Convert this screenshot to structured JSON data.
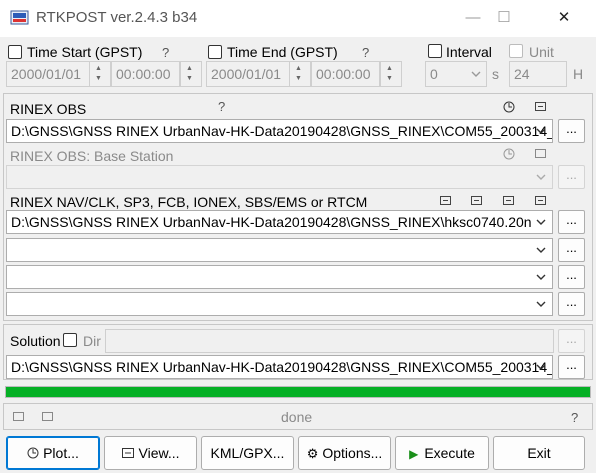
{
  "window": {
    "title": "RTKPOST ver.2.4.3 b34",
    "controls": [
      "—",
      "☐",
      "✕"
    ]
  },
  "time_start": {
    "label": "Time Start (GPST)",
    "help": "?",
    "date": "2000/01/01",
    "time": "00:00:00",
    "checked": false
  },
  "time_end": {
    "label": "Time End (GPST)",
    "help": "?",
    "date": "2000/01/01",
    "time": "00:00:00",
    "checked": false
  },
  "interval": {
    "label": "Interval",
    "value": "0",
    "unit": "s"
  },
  "unit": {
    "label": "Unit",
    "value": "24",
    "unit": "H"
  },
  "rinex_obs": {
    "label": "RINEX OBS",
    "help": "?",
    "path": "D:\\GNSS\\GNSS RINEX UrbanNav-HK-Data20190428\\GNSS_RINEX\\COM55_200314_("
  },
  "rinex_obs_base": {
    "label": "RINEX OBS: Base Station",
    "path": ""
  },
  "rinex_nav": {
    "label": "RINEX NAV/CLK, SP3, FCB, IONEX, SBS/EMS  or RTCM",
    "paths": [
      "D:\\GNSS\\GNSS RINEX UrbanNav-HK-Data20190428\\GNSS_RINEX\\hksc0740.20n",
      "",
      "",
      ""
    ]
  },
  "solution": {
    "label": "Solution",
    "dir_label": "Dir",
    "dir_value": "",
    "path": "D:\\GNSS\\GNSS RINEX UrbanNav-HK-Data20190428\\GNSS_RINEX\\COM55_200314_("
  },
  "browse_label": "...",
  "progress": {
    "fraction": 1.0,
    "color": "#06b025"
  },
  "status": {
    "text": "done",
    "help": "?"
  },
  "buttons": {
    "plot": "Plot...",
    "view": "View...",
    "kml": "KML/GPX...",
    "options": "Options...",
    "execute": "Execute",
    "exit": "Exit"
  },
  "colors": {
    "accent": "#0078d4",
    "execute_icon": "#1a8f1a"
  }
}
